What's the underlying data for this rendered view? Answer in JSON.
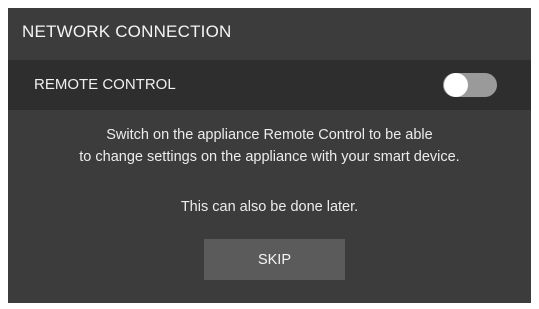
{
  "dialog": {
    "title": "NETWORK CONNECTION",
    "remote_control": {
      "label": "REMOTE CONTROL",
      "toggle_state": "off"
    },
    "description_line1": "Switch on the appliance Remote Control to be able",
    "description_line2": "to change settings on the appliance with your smart device.",
    "note": "This can also be done later.",
    "skip_label": "SKIP"
  },
  "colors": {
    "background": "#3c3c3c",
    "row_background": "#2e2e2e",
    "toggle_track": "#9a9a9a",
    "toggle_knob": "#ffffff",
    "button": "#5b5b5b",
    "text": "#f2f2f2"
  }
}
